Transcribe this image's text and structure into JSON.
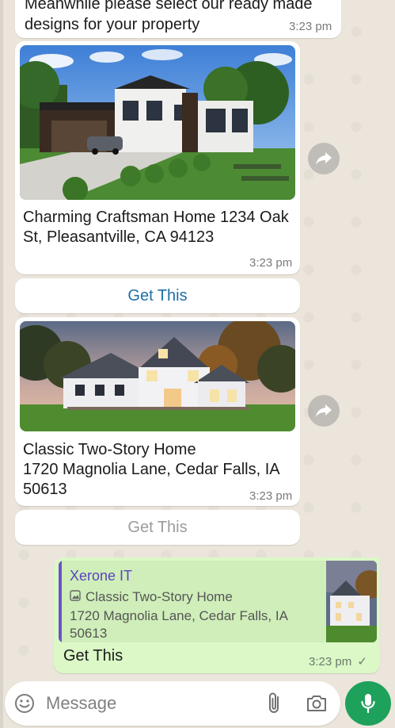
{
  "messages": {
    "intro": {
      "text": "Meanwhile please select our ready made designs for your property",
      "time": "3:23 pm"
    },
    "card1": {
      "description": "Charming Craftsman Home 1234 Oak St, Pleasantville, CA 94123",
      "time": "3:23 pm",
      "button_label": "Get This"
    },
    "card2": {
      "description": "Classic Two-Story Home\n1720 Magnolia Lane, Cedar Falls, IA 50613",
      "time": "3:23 pm",
      "button_label": "Get This"
    },
    "reply": {
      "quoted_sender": "Xerone IT",
      "quoted_title": "Classic Two-Story Home",
      "quoted_address": "1720 Magnolia Lane, Cedar Falls, IA 50613",
      "text": "Get This",
      "time": "3:23 pm",
      "status": "✓"
    }
  },
  "composer": {
    "placeholder": "Message"
  },
  "icons": {
    "forward": "forward-icon",
    "emoji": "emoji-icon",
    "attach": "paperclip-icon",
    "camera": "camera-icon",
    "mic": "microphone-icon",
    "photo": "photo-icon"
  },
  "colors": {
    "accent_green": "#1ea15b",
    "link_blue": "#1e6fa8",
    "outgoing_bubble": "#dbf8c6",
    "quote_bar": "#6b54c8"
  }
}
